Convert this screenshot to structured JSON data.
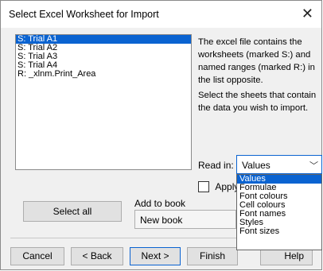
{
  "window": {
    "title": "Select Excel Worksheet for Import",
    "close_glyph": "✕"
  },
  "sheets_list": {
    "items": [
      "S: Trial A1",
      "S: Trial A2",
      "S: Trial A3",
      "S: Trial A4",
      "R: _xlnm.Print_Area"
    ],
    "selected_index": 0
  },
  "description": {
    "para1": "The excel file contains the worksheets (marked S:) and named ranges (marked R:) in the list opposite.",
    "para2": "Select the sheets that contain the data you wish to import."
  },
  "read_in": {
    "label": "Read in:",
    "value": "Values",
    "options": [
      "Values",
      "Formulae",
      "Font colours",
      "Cell colours",
      "Font names",
      "Styles",
      "Font sizes"
    ],
    "selected_index": 0
  },
  "apply": {
    "label_visible": "Apply s",
    "checked": false
  },
  "add_to_book": {
    "label": "Add to book",
    "value": "New book"
  },
  "buttons": {
    "select_all": "Select all",
    "cancel": "Cancel",
    "back": "< Back",
    "next": "Next >",
    "finish": "Finish",
    "help": "Help"
  },
  "colors": {
    "selection": "#0a63d1",
    "focus_border": "#0a63d1"
  },
  "icons": {
    "close": "close-icon",
    "dropdown": "chevron-down-icon"
  }
}
